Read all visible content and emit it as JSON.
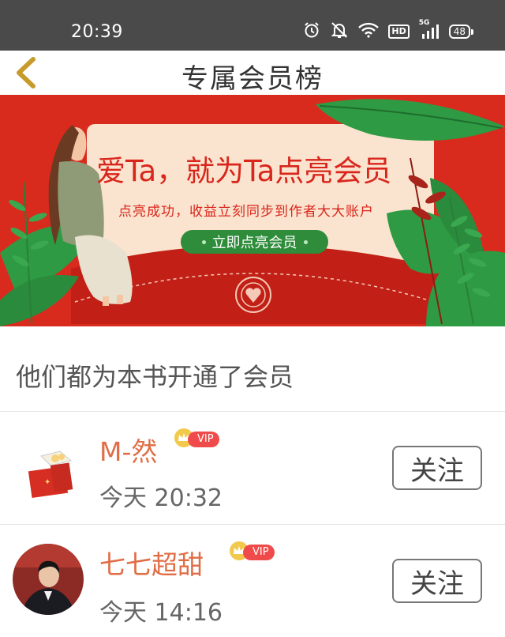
{
  "status_bar": {
    "time": "20:39",
    "network_label": "5G",
    "hd_label": "HD",
    "battery": "48",
    "icons": [
      "alarm-icon",
      "mute-icon",
      "wifi-icon",
      "hd-icon",
      "signal-icon",
      "battery-icon"
    ]
  },
  "header": {
    "title": "专属会员榜",
    "back_icon": "chevron-left-icon"
  },
  "banner": {
    "headline": "爱Ta，就为Ta点亮会员",
    "subtitle": "点亮成功，收益立刻同步到作者大大账户",
    "cta_label": "立即点亮会员",
    "colors": {
      "background": "#d92a1e",
      "panel": "#fbe4cf",
      "cta": "#2e8c3a",
      "leaf": "#2f9a44"
    }
  },
  "section": {
    "title": "他们都为本书开通了会员"
  },
  "members": [
    {
      "name": "M-然",
      "badge": "VIP",
      "time": "今天 20:32",
      "follow_label": "关注"
    },
    {
      "name": "七七超甜",
      "badge": "VIP",
      "time": "今天 14:16",
      "follow_label": "关注"
    }
  ],
  "colors": {
    "name": "#e06d45",
    "vip_badge": "#f04b4b",
    "status_bar": "#4a4a4a"
  }
}
